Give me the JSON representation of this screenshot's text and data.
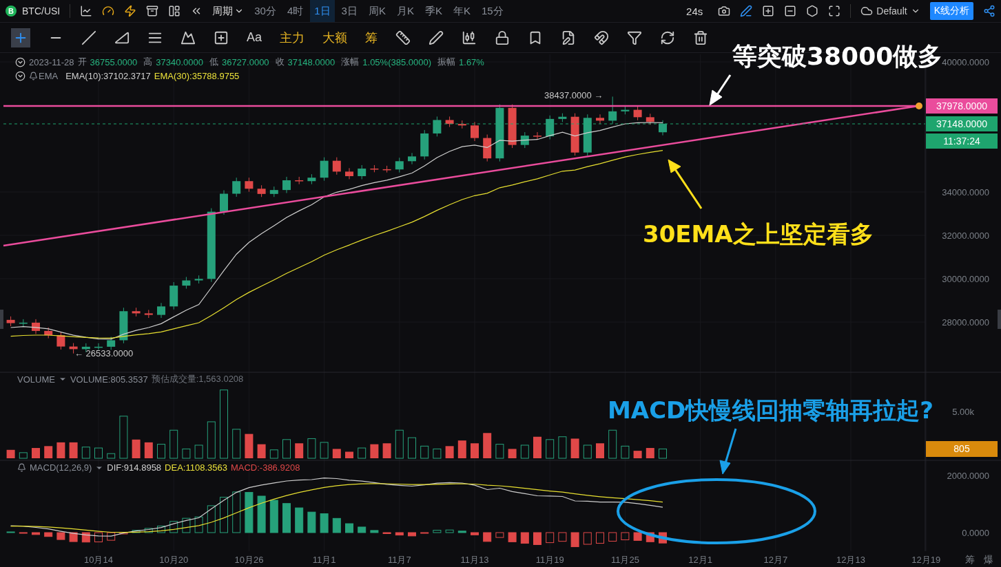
{
  "symbol": {
    "logo": "B",
    "label": "BTC/USI"
  },
  "top_toolbar": {
    "period_menu": "周期",
    "intervals": [
      {
        "label": "30分",
        "selected": false
      },
      {
        "label": "4时",
        "selected": false
      },
      {
        "label": "1日",
        "selected": true
      },
      {
        "label": "3日",
        "selected": false
      },
      {
        "label": "周K",
        "selected": false
      },
      {
        "label": "月K",
        "selected": false
      },
      {
        "label": "季K",
        "selected": false
      },
      {
        "label": "年K",
        "selected": false
      },
      {
        "label": "15分",
        "selected": false
      }
    ],
    "countdown": "24s",
    "layout": "Default",
    "analysis_button": "K线分析"
  },
  "drawing_toolbar": {
    "crosshair_active": true,
    "text_tools": [
      {
        "label": "Aa",
        "kind": "plain"
      },
      {
        "label": "主力",
        "kind": "accent"
      },
      {
        "label": "大额",
        "kind": "accent"
      },
      {
        "label": "筹",
        "kind": "accent"
      }
    ]
  },
  "main_pane": {
    "date": "2023-11-28",
    "ohlc": [
      {
        "label": "开",
        "value": "36755.0000"
      },
      {
        "label": "高",
        "value": "37340.0000"
      },
      {
        "label": "低",
        "value": "36727.0000"
      },
      {
        "label": "收",
        "value": "37148.0000"
      },
      {
        "label": "涨幅",
        "value": "1.05%(385.0000)"
      },
      {
        "label": "振幅",
        "value": "1.67%"
      }
    ],
    "indicator": {
      "name": "EMA",
      "lines": [
        {
          "text": "EMA(10):37102.3717",
          "color": "#d0d0d0"
        },
        {
          "text": "EMA(30):35788.9755",
          "color": "#ece23a"
        }
      ]
    },
    "y_ticks": [
      "40000.0000",
      "34000.0000",
      "32000.0000",
      "30000.0000",
      "28000.0000"
    ],
    "high_marker": "38437.0000 →",
    "low_marker": "← 26533.0000",
    "price_tags": [
      {
        "kind": "line",
        "text": "37978.0000"
      },
      {
        "kind": "last",
        "text": "37148.0000"
      },
      {
        "kind": "countdown",
        "text": "11:37:24"
      }
    ]
  },
  "volume_pane": {
    "name": "VOLUME",
    "value": "VOLUME:805.3537",
    "estimate": "预估成交量:1,563.0208",
    "y_tick": "5.00k",
    "tag": "805"
  },
  "macd_pane": {
    "name": "MACD(12,26,9)",
    "lines": [
      {
        "text": "DIF:914.8958",
        "color": "#d0d0d0"
      },
      {
        "text": "DEA:1108.3563",
        "color": "#ece23a"
      },
      {
        "text": "MACD:-386.9208",
        "color": "#e04848"
      }
    ],
    "y_ticks": [
      "2000.0000",
      "0.0000"
    ]
  },
  "x_axis": {
    "labels": [
      "10月14",
      "10月20",
      "10月26",
      "11月1",
      "11月7",
      "11月13",
      "11月19",
      "11月25",
      "12月1",
      "12月7",
      "12月13",
      "12月19"
    ],
    "corner": [
      "筹",
      "爆"
    ]
  },
  "annotations": [
    {
      "kind": "headline",
      "text": "等突破38000做多",
      "color": "#ffffff"
    },
    {
      "kind": "ema-note",
      "text": "30EMA之上坚定看多",
      "color": "#ffe01a"
    },
    {
      "kind": "macd-note",
      "text": "MACD快慢线回抽零轴再拉起?",
      "color": "#1aa0e8"
    }
  ]
}
